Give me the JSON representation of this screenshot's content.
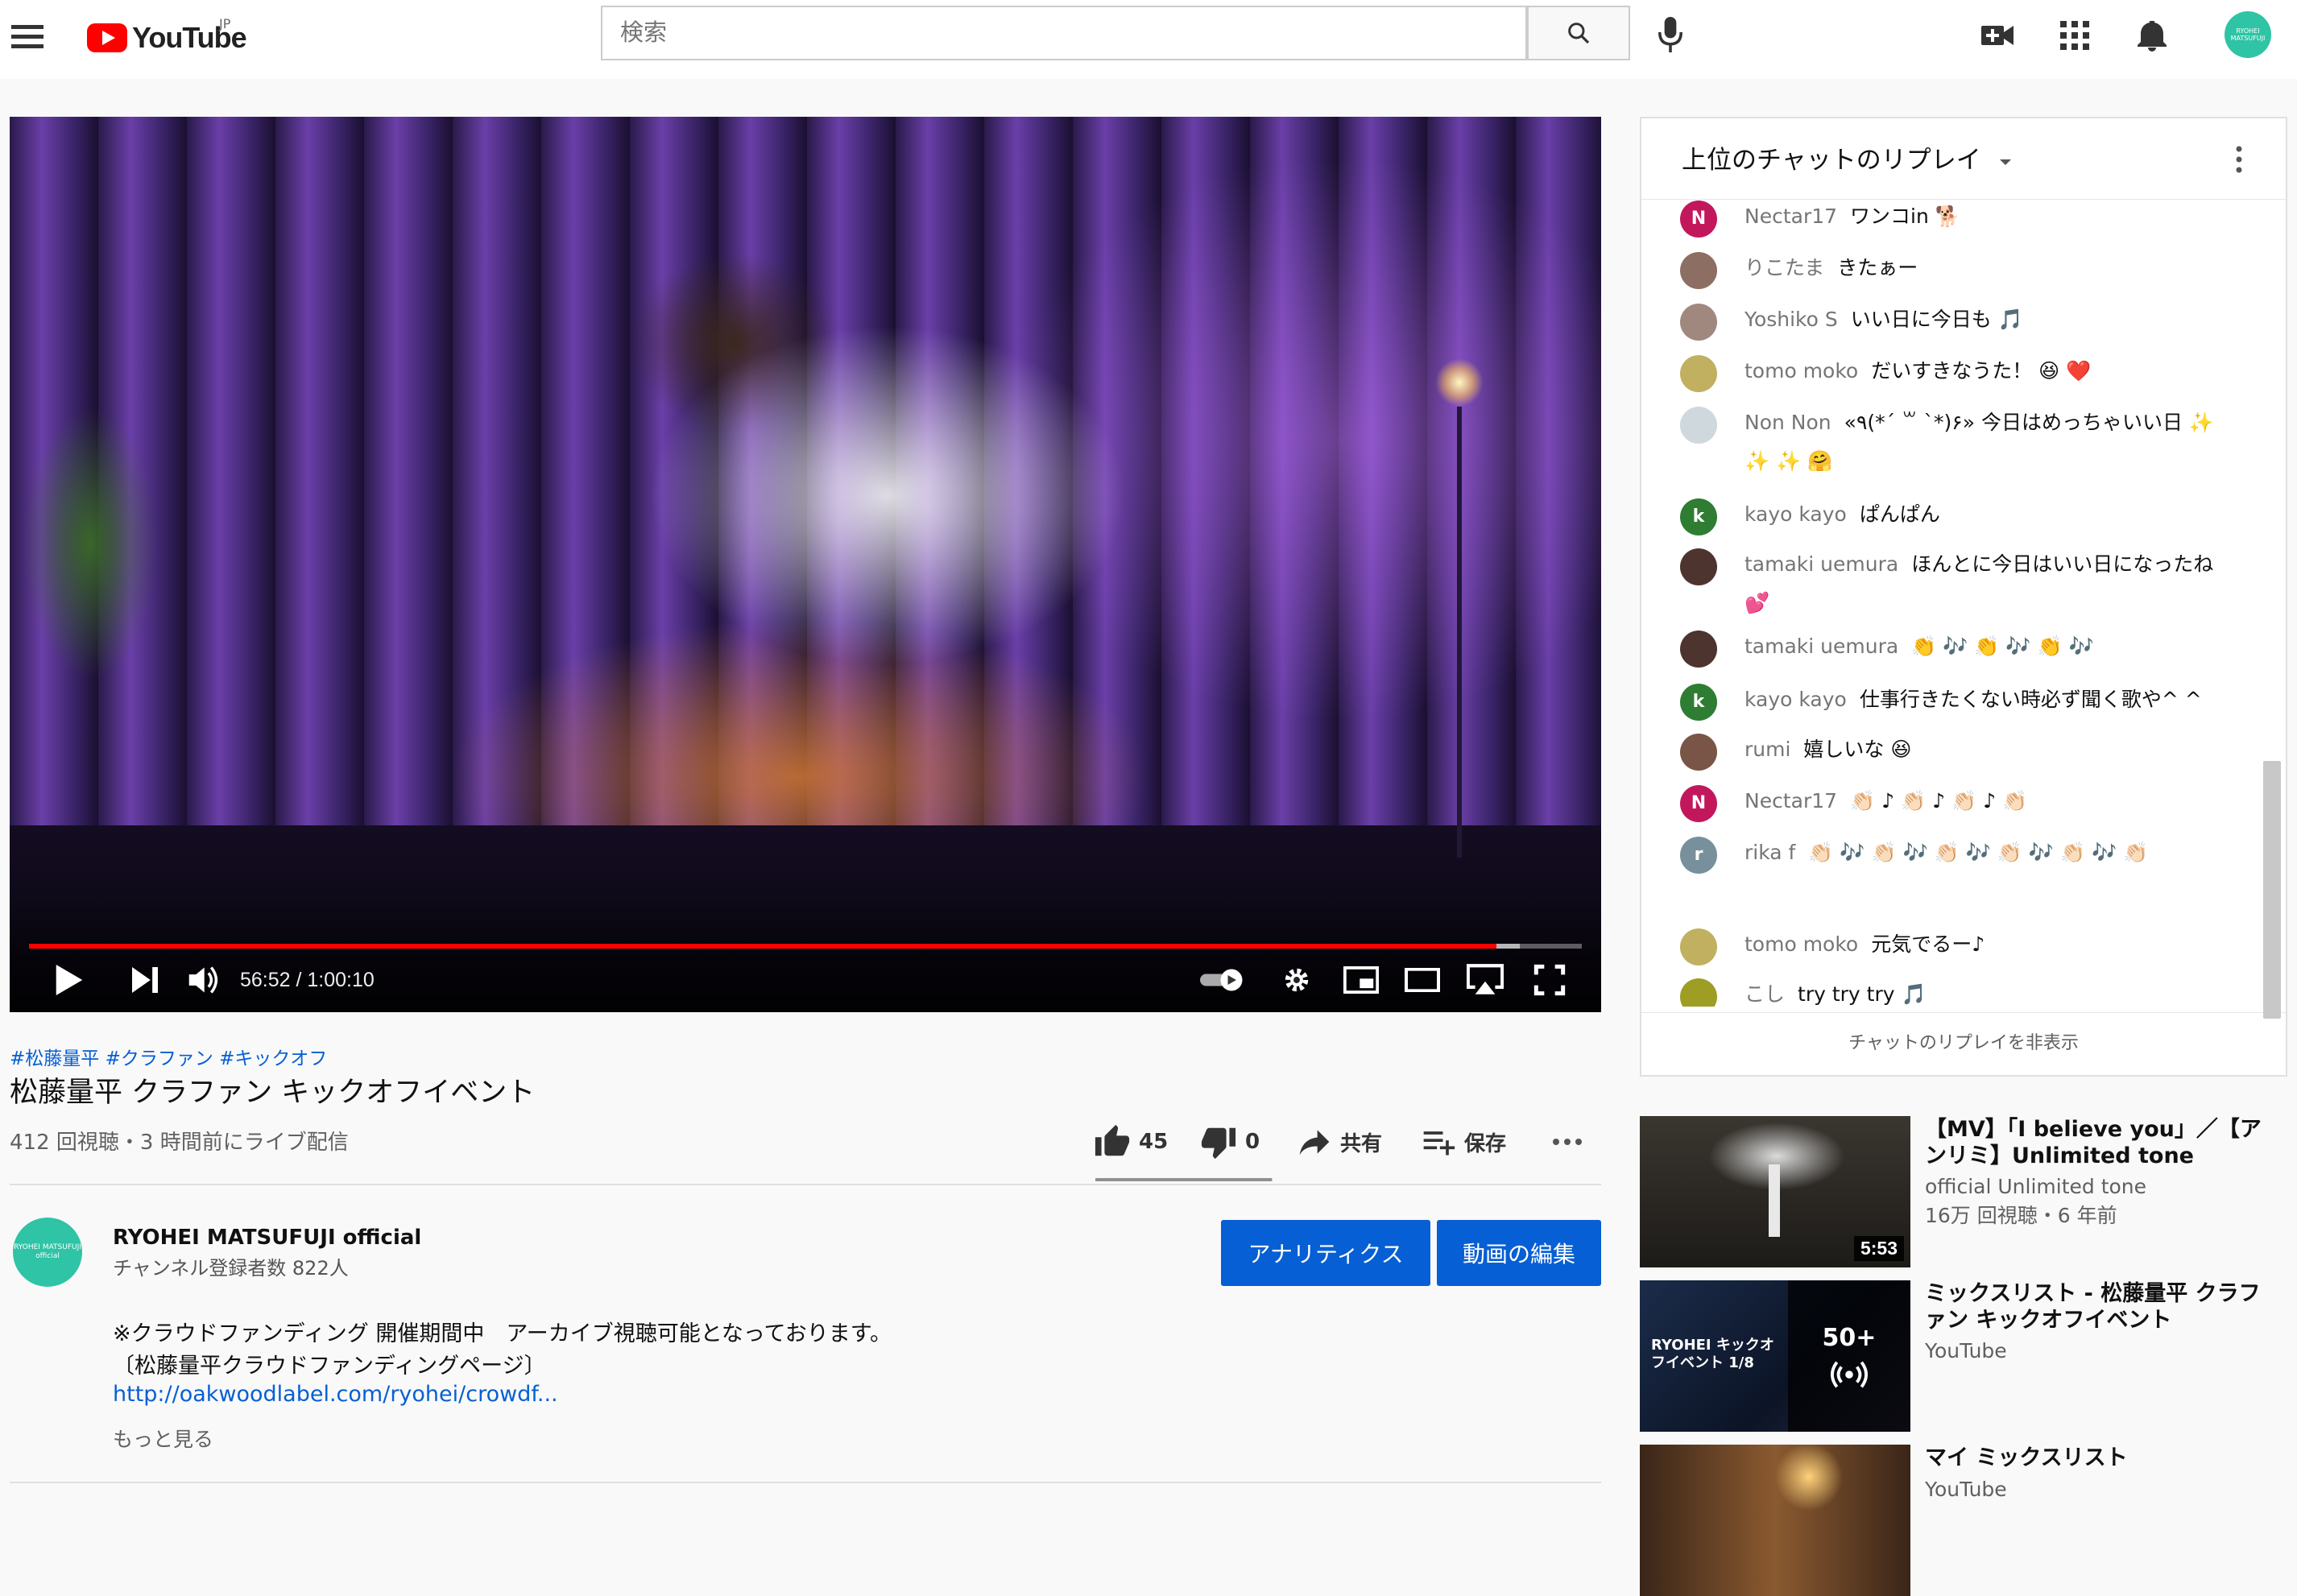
{
  "topbar": {
    "logo_text": "YouTube",
    "logo_region": "JP",
    "search_placeholder": "検索"
  },
  "player": {
    "current_time": "56:52",
    "duration": "1:00:10",
    "time_display": "56:52 / 1:00:10",
    "progress_fraction": 0.945
  },
  "video": {
    "hashtags": "#松藤量平 #クラファン #キックオフ",
    "title": "松藤量平 クラファン キックオフイベント",
    "views": "412 回視聴・3 時間前にライブ配信",
    "likes": "45",
    "dislikes": "0",
    "share_label": "共有",
    "save_label": "保存"
  },
  "channel": {
    "avatar_text": "RYOHEI MATSUFUJI official",
    "name": "RYOHEI MATSUFUJI official",
    "subscribers": "チャンネル登録者数 822人",
    "analytics_label": "アナリティクス",
    "edit_label": "動画の編集"
  },
  "description": {
    "line1": "※クラウドファンディング 開催期間中　アーカイブ視聴可能となっております。",
    "line2": "〔松藤量平クラウドファンディングページ〕",
    "link": "http://oakwoodlabel.com/ryohei/crowdf...",
    "more": "もっと見る"
  },
  "chat": {
    "header": "上位のチャットのリプレイ",
    "hide_label": "チャットのリプレイを非表示",
    "messages": [
      {
        "author": "Nectar17",
        "text": "ワンコin 🐕",
        "avatar": "N",
        "color": "#c2185b"
      },
      {
        "author": "りこたま",
        "text": "きたぁー",
        "avatar": "",
        "color": "#8d6e63"
      },
      {
        "author": "Yoshiko S",
        "text": "いい日に今日も 🎵",
        "avatar": "",
        "color": "#a1887f"
      },
      {
        "author": "tomo moko",
        "text": "だいすきなうた！ 😆 ❤️",
        "avatar": "",
        "color": "#c0b060"
      },
      {
        "author": "Non Non",
        "text": "«٩(*´ ꒳ `*)۶» 今日はめっちゃいい日 ✨ ✨ ✨ 🤗",
        "avatar": "",
        "color": "#cfd8dc"
      },
      {
        "author": "kayo kayo",
        "text": "ぱんぱん",
        "avatar": "k",
        "color": "#2e7d32"
      },
      {
        "author": "tamaki uemura",
        "text": "ほんとに今日はいい日になったね 💕",
        "avatar": "",
        "color": "#4e342e"
      },
      {
        "author": "tamaki uemura",
        "text": "👏 🎶 👏 🎶 👏 🎶",
        "avatar": "",
        "color": "#4e342e"
      },
      {
        "author": "kayo kayo",
        "text": "仕事行きたくない時必ず聞く歌や^ ^",
        "avatar": "k",
        "color": "#2e7d32"
      },
      {
        "author": "rumi",
        "text": "嬉しいな 😆",
        "avatar": "",
        "color": "#795548"
      },
      {
        "author": "Nectar17",
        "text": "👏🏻 ♪ 👏🏻 ♪ 👏🏻 ♪ 👏🏻",
        "avatar": "N",
        "color": "#c2185b"
      },
      {
        "author": "rika f",
        "text": "👏🏻 🎶 👏🏻 🎶 👏🏻 🎶 👏🏻 🎶 👏🏻 🎶 👏🏻",
        "avatar": "r",
        "color": "#78909c"
      },
      {
        "author": "tomo moko",
        "text": "元気でるー♪",
        "avatar": "",
        "color": "#c0b060"
      },
      {
        "author": "こし",
        "text": "try try try 🎵",
        "avatar": "",
        "color": "#9e9d24"
      }
    ]
  },
  "recommendations": [
    {
      "title": "【MV】「I believe you」／【アンリミ】Unlimited tone",
      "channel": "official Unlimited tone",
      "meta": "16万 回視聴・6 年前",
      "duration": "5:53"
    },
    {
      "title": "ミックスリスト - 松藤量平 クラファン キックオフイベント",
      "channel": "YouTube",
      "badge": "50+",
      "thumb_text": "RYOHEI キックオフイベント 1/8"
    },
    {
      "title": "マイ ミックスリスト",
      "channel": "YouTube"
    }
  ],
  "colors": {
    "accent": "#065fd4",
    "progress": "#ff0000",
    "logo_red": "#ff0000",
    "avatar_teal": "#2ec4a5"
  }
}
